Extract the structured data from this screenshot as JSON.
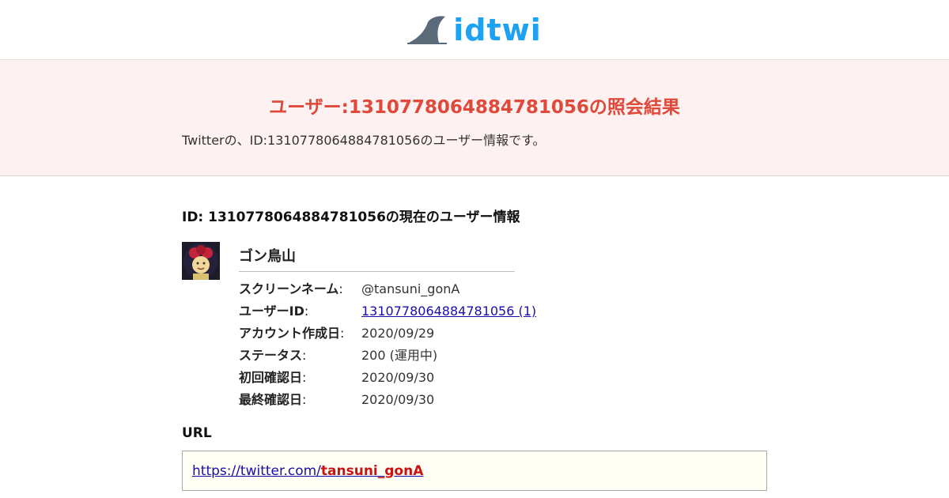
{
  "header": {
    "logo_text": "idtwi",
    "logo_color": "#1da1f2"
  },
  "hero": {
    "title": "ユーザー:1310778064884781056の照会結果",
    "description": "Twitterの、ID:1310778064884781056のユーザー情報です。",
    "title_color": "#e0483a"
  },
  "main": {
    "section_title": "ID: 1310778064884781056の現在のユーザー情報",
    "user": {
      "name": "ゴン鳥山",
      "rows": [
        {
          "label": "スクリーンネーム",
          "colon": ":",
          "value": "@tansuni_gonA"
        },
        {
          "label": "ユーザーID",
          "colon": ":",
          "value": "1310778064884781056 (1)"
        },
        {
          "label": "アカウント作成日",
          "colon": ":",
          "value": "2020/09/29"
        },
        {
          "label": "ステータス",
          "colon": ":",
          "value": "200 (運用中)"
        },
        {
          "label": "初回確認日",
          "colon": ":",
          "value": "2020/09/30"
        },
        {
          "label": "最終確認日",
          "colon": ":",
          "value": "2020/09/30"
        }
      ]
    },
    "url_section": {
      "title": "URL",
      "url_prefix": "https://twitter.com/",
      "url_handle": "tansuni_gonA"
    }
  }
}
